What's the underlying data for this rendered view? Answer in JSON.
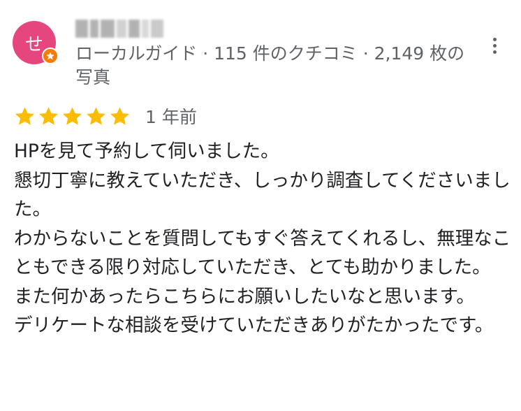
{
  "reviewer": {
    "avatar_initial": "せ",
    "meta_line": "ローカルガイド · 115 件のクチコミ · 2,149 枚の写真"
  },
  "rating": {
    "stars": 5,
    "max_stars": 5,
    "date": "1 年前"
  },
  "review_lines": [
    "HPを見て予約して伺いました。",
    "懇切丁寧に教えていただき、しっかり調査してくださいました。",
    "わからないことを質問してもすぐ答えてくれるし、無理なこともできる限り対応していただき、とても助かりました。",
    "また何かあったらこちらにお願いしたいなと思います。",
    "デリケートな相談を受けていただきありがたかったです。"
  ],
  "colors": {
    "avatar": "#e5467d",
    "local_guide_badge": "#f57c00",
    "star": "#fbbc04",
    "secondary_text": "#5f6368",
    "primary_text": "#202124"
  },
  "icons": {
    "badge": "local-guide-star-icon",
    "menu": "more-vert-icon",
    "rating": "star-icon"
  }
}
